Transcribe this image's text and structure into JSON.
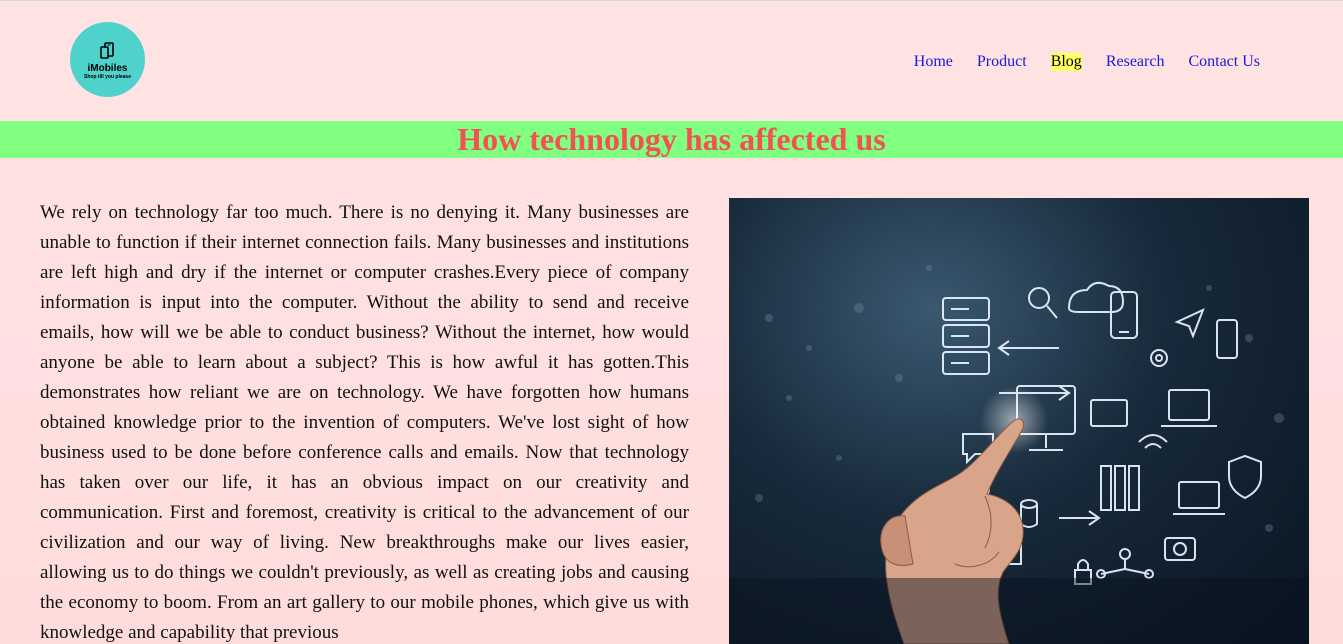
{
  "logo": {
    "name": "iMobiles",
    "tagline": "Shop till you please",
    "icon": "phones-icon",
    "color": "#4fd1cc"
  },
  "nav": {
    "items": [
      {
        "label": "Home"
      },
      {
        "label": "Product"
      },
      {
        "label": "Blog",
        "active": true
      },
      {
        "label": "Research"
      },
      {
        "label": "Contact Us"
      }
    ]
  },
  "banner": {
    "title": "How technology has affected us",
    "background": "#80ff80",
    "color": "#f25252"
  },
  "article": {
    "text": "We rely on technology far too much. There is no denying it. Many businesses are unable to function if their internet connection fails. Many businesses and institutions are left high and dry if the internet or computer crashes.Every piece of company information is input into the computer. Without the ability to send and receive emails, how will we be able to conduct business? Without the internet, how would anyone be able to learn about a subject? This is how awful it has gotten.This demonstrates how reliant we are on technology. We have forgotten how humans obtained knowledge prior to the invention of computers. We've lost sight of how business used to be done before conference calls and emails. Now that technology has taken over our life, it has an obvious impact on our creativity and communication. First and foremost, creativity is critical to the advancement of our civilization and our way of living. New breakthroughs make our lives easier, allowing us to do things we couldn't previously, as well as creating jobs and causing the economy to boom. From an art gallery to our mobile phones, which give us with knowledge and capability that previous"
  },
  "image": {
    "icon": "technology-hand-illustration"
  }
}
